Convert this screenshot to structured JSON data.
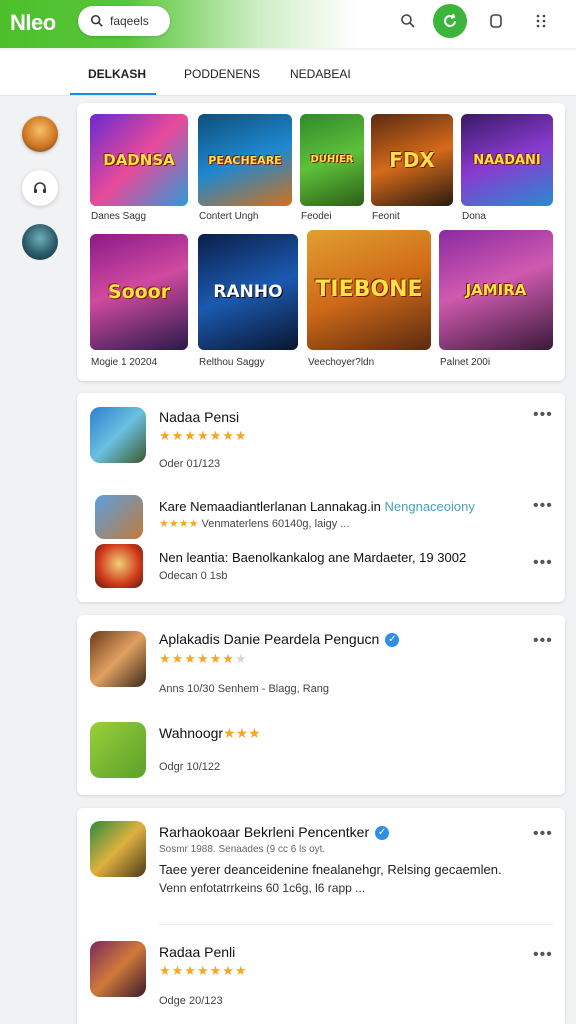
{
  "header": {
    "logo": "Nleo",
    "search_text": "faqeels"
  },
  "tabs": [
    {
      "label": "DELKASH"
    },
    {
      "label": "PODDENENS"
    },
    {
      "label": "NEDABEAI"
    }
  ],
  "featured": [
    {
      "title": "DADNSA",
      "caption": "Danes Sagg"
    },
    {
      "title": "PEACHEARE",
      "caption": "Contert Ungh"
    },
    {
      "title": "DUHIER",
      "caption": "Feodei"
    },
    {
      "title": "FDX",
      "caption": "Feonit"
    },
    {
      "title": "NAADANI",
      "caption": "Dona"
    },
    {
      "title": "Sooor",
      "caption": "Mogie 1 20204"
    },
    {
      "title": "RANHO",
      "caption": "Relthou Saggy"
    },
    {
      "title": "TIEBONE",
      "caption": "Veechoyer?ldn"
    },
    {
      "title": "JAMIRA",
      "caption": "Palnet 200i"
    }
  ],
  "section1": {
    "items": [
      {
        "name": "Nadaa Pensi",
        "sub": "Oder 01/123",
        "rating": 5
      },
      {
        "name": "Kare Nemaadiantlerlanan Lannakag.in",
        "name_tag": "Nengnaceoiony",
        "sub": "Venmaterlens 60140g, laigy ..."
      },
      {
        "name": "Nen leantia: Baenolkankalog ane Mardaeter, 19 3002",
        "sub": "Odecan 0 1sb"
      }
    ]
  },
  "section2": {
    "items": [
      {
        "name": "Aplakadis Danie Peardela Pengucn",
        "sub": "Anns 10/30 Senhem - Blagg, Rang",
        "rating": 4.5
      },
      {
        "name": "Wahnoogr",
        "sub": "Odgr 10/122"
      }
    ]
  },
  "section3": {
    "items": [
      {
        "name": "Rarhaokoaar Bekrleni Pencentker",
        "sub": "Sosmr 1988. Senaades (9 cc 6 ls oyt.",
        "sub2": "Taee yerer deanceidenine fnealanehgr, Relsing gecaemlen.",
        "sub3": "Venn enfotatrrkeins 60 1c6g, l6 rapp ..."
      },
      {
        "name": "Radaa Penli",
        "sub": "Odge 20/123",
        "rating": 5
      }
    ]
  },
  "colors": {
    "brand_green": "#4cbf2b",
    "accent_blue": "#1e88e5",
    "star": "#f5a623"
  }
}
